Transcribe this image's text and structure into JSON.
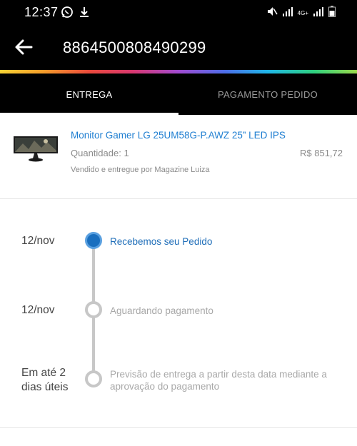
{
  "status_bar": {
    "time": "12:37",
    "network_label": "4G+"
  },
  "header": {
    "order_number": "8864500808490299"
  },
  "tabs": [
    {
      "label": "ENTREGA",
      "active": true
    },
    {
      "label": "PAGAMENTO PEDIDO",
      "active": false
    }
  ],
  "product": {
    "name": "Monitor Gamer LG 25UM58G-P.AWZ 25” LED IPS",
    "quantity": "Quantidade: 1",
    "price": "R$ 851,72",
    "seller": "Vendido e entregue por Magazine Luiza"
  },
  "timeline": {
    "steps": [
      {
        "date": "12/nov",
        "label": "Recebemos seu Pedido",
        "status": "done"
      },
      {
        "date": "12/nov",
        "label": "Aguardando pagamento",
        "status": "pending"
      },
      {
        "date": "Em até 2 dias úteis",
        "label": "Previsão de entrega a partir desta data mediante a aprovação do pagamento",
        "status": "pending"
      }
    ]
  },
  "colors": {
    "accent": "#1e7ed1",
    "done_dot": "#1a6fbf",
    "pending": "#c7c7c7"
  }
}
